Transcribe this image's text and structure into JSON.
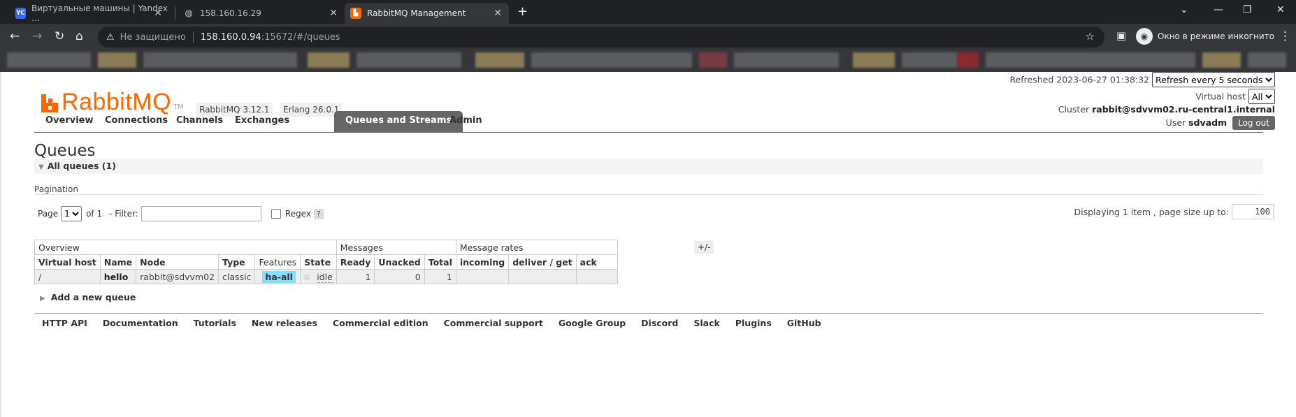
{
  "browser": {
    "tabs": [
      {
        "title": "Виртуальные машины | Yandex …",
        "favicon": "YC"
      },
      {
        "title": "158.160.16.29",
        "favicon": "globe-icon"
      },
      {
        "title": "RabbitMQ Management",
        "favicon": "rabbitmq-icon"
      }
    ],
    "address": {
      "security": "Не защищено",
      "host": "158.160.0.94",
      "path": ":15672/#/queues"
    },
    "incognito_label": "Окно в режиме инкогнито"
  },
  "header": {
    "logo_text": "RabbitMQ",
    "logo_tm": "TM",
    "rabbit_version": "RabbitMQ 3.12.1",
    "erlang_version": "Erlang 26.0.1",
    "refreshed_label": "Refreshed 2023-06-27 01:38:32",
    "refresh_option": "Refresh every 5 seconds",
    "vhost_label": "Virtual host",
    "vhost_value": "All",
    "cluster_label": "Cluster",
    "cluster_value": "rabbit@sdvvm02.ru-central1.internal",
    "user_label": "User",
    "user_value": "sdvadm",
    "logout_label": "Log out"
  },
  "nav": [
    "Overview",
    "Connections",
    "Channels",
    "Exchanges",
    "Queues and Streams",
    "Admin"
  ],
  "page_title": "Queues",
  "section_title": "All queues (1)",
  "pagination": {
    "label": "Pagination",
    "page_label": "Page",
    "page_value": "1",
    "of_label": "of 1",
    "filter_label": "- Filter:",
    "regex_label": "Regex",
    "help": "?",
    "display_label": "Displaying 1 item , page size up to:",
    "page_size": "100"
  },
  "table": {
    "groups": [
      "Overview",
      "Messages",
      "Message rates"
    ],
    "columns": [
      "Virtual host",
      "Name",
      "Node",
      "Type",
      "Features",
      "State",
      "Ready",
      "Unacked",
      "Total",
      "incoming",
      "deliver / get",
      "ack"
    ],
    "row": {
      "vhost": "/",
      "name": "hello",
      "node": "rabbit@sdvvm02",
      "type": "classic",
      "feature": "ha-all",
      "state": "idle",
      "ready": "1",
      "unacked": "0",
      "total": "1"
    },
    "toggle": "+/-"
  },
  "add_queue": "Add a new queue",
  "footer": [
    "HTTP API",
    "Documentation",
    "Tutorials",
    "New releases",
    "Commercial edition",
    "Commercial support",
    "Google Group",
    "Discord",
    "Slack",
    "Plugins",
    "GitHub"
  ]
}
